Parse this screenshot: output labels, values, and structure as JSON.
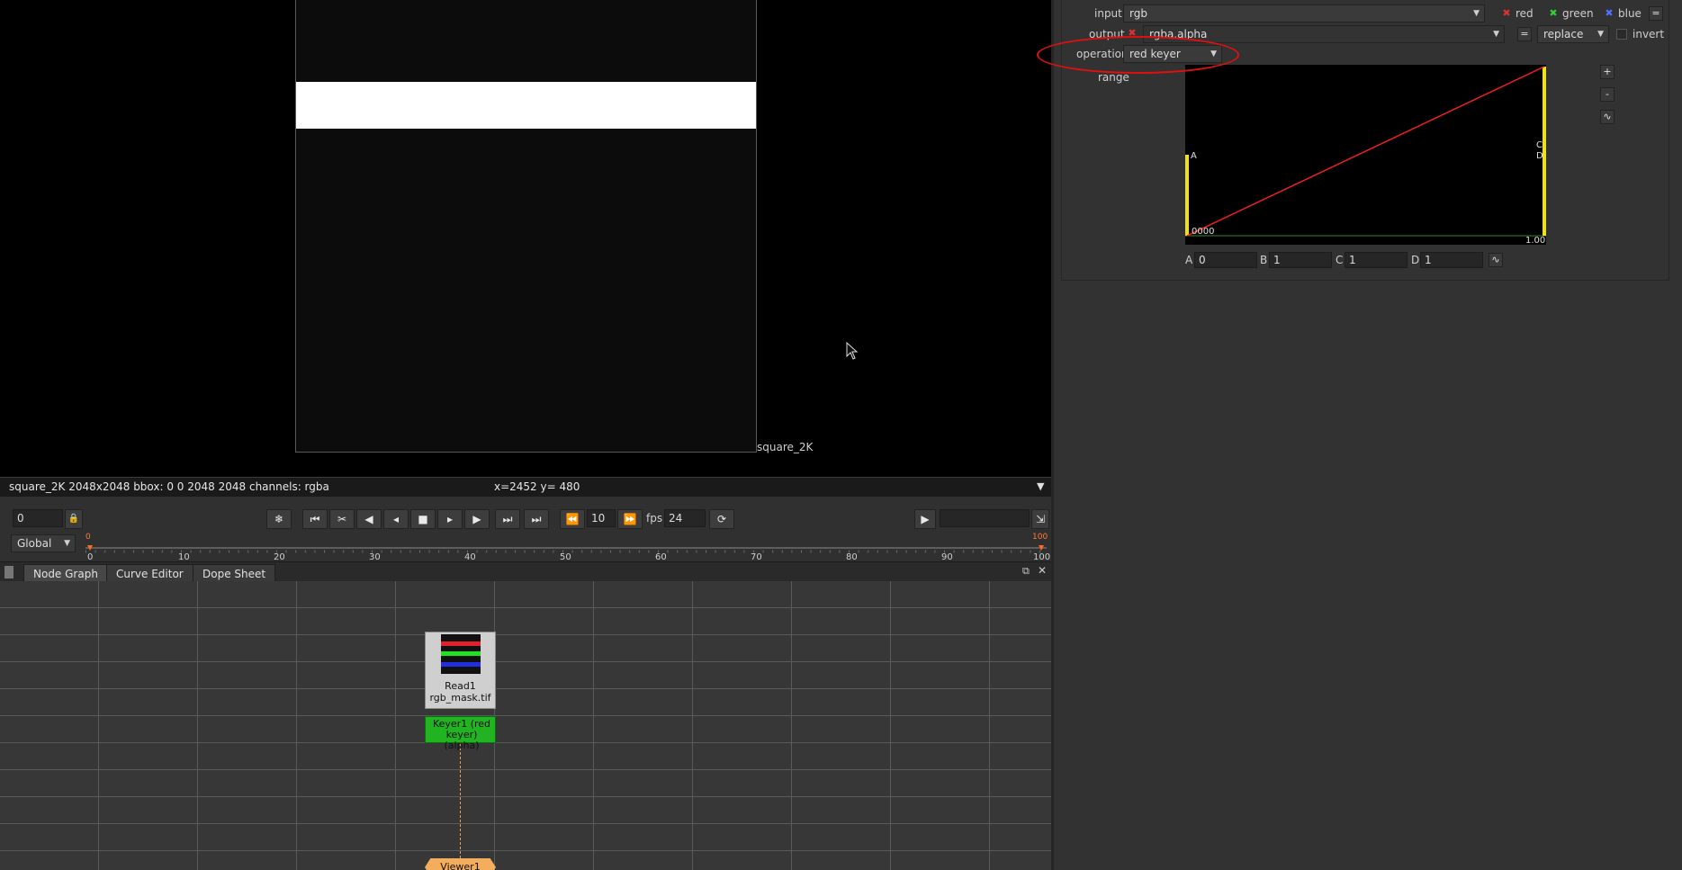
{
  "viewer": {
    "image_label": "square_2K",
    "info": "square_2K 2048x2048 bbox: 0 0 2048 2048 channels: rgba",
    "coords": "x=2452 y= 480",
    "dropdown_glyph": "▼"
  },
  "transport": {
    "frame_value": "0",
    "lock_glyph": "🔒",
    "play_icons": [
      "❄",
      "⏮",
      "✂",
      "◀",
      "◂",
      "■",
      "▸",
      "▶",
      "⏭",
      "⏭"
    ],
    "step_value": "10",
    "fps_label": "fps",
    "fps_value": "24",
    "scope_value": "Global",
    "end_value": "100",
    "ticks": [
      "0",
      "10",
      "20",
      "30",
      "40",
      "50",
      "60",
      "70",
      "80",
      "90",
      "100"
    ],
    "start_marker": "0",
    "end_marker": "100"
  },
  "nodegraph": {
    "tabs": [
      {
        "label": "Node Graph"
      },
      {
        "label": "Curve Editor"
      },
      {
        "label": "Dope Sheet"
      }
    ],
    "read_node": {
      "line1": "Read1",
      "line2": "rgb_mask.tif"
    },
    "keyer_node": {
      "line1": "Keyer1 (red keyer)",
      "line2": "(alpha)"
    },
    "viewer_node": {
      "label": "Viewer1"
    }
  },
  "props": {
    "input_label": "input",
    "input_value": "rgb",
    "chk_red": "red",
    "chk_green": "green",
    "chk_blue": "blue",
    "output_label": "output",
    "output_value": "rgba.alpha",
    "replace_value": "replace",
    "invert_label": "invert",
    "operation_label": "operation",
    "operation_value": "red keyer",
    "range_label": "range",
    "curve_a": "A",
    "curve_c": "C",
    "curve_d": "D",
    "curve_start": "0000",
    "curve_end": "1.00",
    "fields": [
      {
        "label": "A",
        "value": "0"
      },
      {
        "label": "B",
        "value": "1"
      },
      {
        "label": "C",
        "value": "1"
      },
      {
        "label": "D",
        "value": "1"
      }
    ]
  }
}
